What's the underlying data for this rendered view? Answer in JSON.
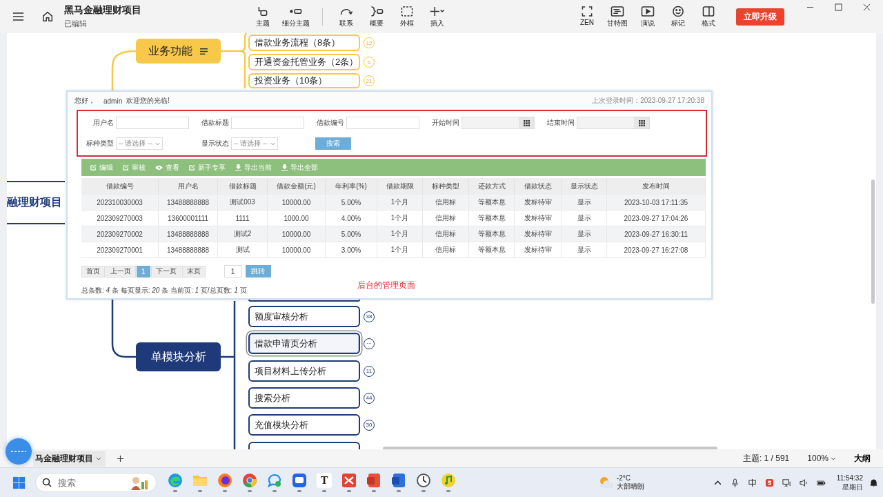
{
  "app": {
    "title": "黑马金融理财项目",
    "subtitle": "已编辑"
  },
  "toolbar": {
    "tools": [
      {
        "label": "主题",
        "kind": "topic"
      },
      {
        "label": "细分主题",
        "kind": "subtopic"
      },
      {
        "label": "联系",
        "kind": "relation"
      },
      {
        "label": "概要",
        "kind": "summary"
      },
      {
        "label": "外框",
        "kind": "boundary"
      },
      {
        "label": "插入",
        "kind": "insert"
      }
    ],
    "views": [
      {
        "label": "ZEN",
        "kind": "zen"
      },
      {
        "label": "甘特图",
        "kind": "gantt"
      },
      {
        "label": "演说",
        "kind": "play"
      },
      {
        "label": "标记",
        "kind": "marker"
      },
      {
        "label": "格式",
        "kind": "format"
      }
    ],
    "upgrade_button": "立即升级"
  },
  "mindmap": {
    "root": "融理财项目",
    "branches": [
      {
        "title": "业务功能",
        "color": "#f7c84a",
        "children": [
          {
            "label": "借款业务流程（8条）",
            "count": "12",
            "selected": false
          },
          {
            "label": "开通资金托管业务（2条）",
            "count": "6",
            "selected": false
          },
          {
            "label": "投资业务（10条）",
            "count": "21",
            "selected": false
          }
        ]
      },
      {
        "title": "单模块分析",
        "color": "#1f3a7a",
        "children": [
          {
            "label": "额度审核分析",
            "count": "38",
            "selected": false
          },
          {
            "label": "借款申请页分析",
            "count": "···",
            "selected": true
          },
          {
            "label": "项目材料上传分析",
            "count": "11",
            "selected": false
          },
          {
            "label": "搜索分析",
            "count": "44",
            "selected": false
          },
          {
            "label": "充值模块分析",
            "count": "30",
            "selected": false
          }
        ]
      }
    ]
  },
  "admin_panel": {
    "greeting": "您好，",
    "user": "admin",
    "welcome": "欢迎您的光临!",
    "last_login": "上次登录时间：2023-09-27 17:20:38",
    "filter_rows": [
      [
        {
          "label": "用户名",
          "kind": "text"
        },
        {
          "label": "借款标题",
          "kind": "text"
        },
        {
          "label": "借款编号",
          "kind": "text"
        },
        {
          "label": "开始时间",
          "kind": "date"
        },
        {
          "label": "结束时间",
          "kind": "date"
        }
      ],
      [
        {
          "label": "标种类型",
          "kind": "select",
          "placeholder": "-- 请选择 --"
        },
        {
          "label": "显示状态",
          "kind": "select",
          "placeholder": "-- 请选择 --"
        }
      ]
    ],
    "search_button": "搜索",
    "actions": [
      {
        "label": "编辑",
        "kind": "edit"
      },
      {
        "label": "审核",
        "kind": "edit"
      },
      {
        "label": "查看",
        "kind": "view"
      },
      {
        "label": "新手专享",
        "kind": "edit"
      },
      {
        "label": "导出当前",
        "kind": "export"
      },
      {
        "label": "导出全部",
        "kind": "export"
      }
    ],
    "table": {
      "columns": [
        "借款编号",
        "用户名",
        "借款标题",
        "借款金额(元)",
        "年利率(%)",
        "借款期限",
        "标种类型",
        "还款方式",
        "借款状态",
        "显示状态",
        "发布时间"
      ],
      "rows": [
        [
          "202310030003",
          "13488888888",
          "测试003",
          "10000.00",
          "5.00%",
          "1个月",
          "信用标",
          "等额本息",
          "发标待审",
          "显示",
          "2023-10-03 17:11:35"
        ],
        [
          "202309270003",
          "13600001111",
          "1111",
          "1000.00",
          "4.00%",
          "1个月",
          "信用标",
          "等额本息",
          "发标待审",
          "显示",
          "2023-09-27 17:04:26"
        ],
        [
          "202309270002",
          "13488888888",
          "测试2",
          "10000.00",
          "5.00%",
          "1个月",
          "信用标",
          "等额本息",
          "发标待审",
          "显示",
          "2023-09-27 16:30:11"
        ],
        [
          "202309270001",
          "13488888888",
          "测试",
          "10000.00",
          "3.00%",
          "1个月",
          "信用标",
          "等额本息",
          "发标待审",
          "显示",
          "2023-09-27 16:27:08"
        ]
      ]
    },
    "pagination": {
      "pages": [
        {
          "label": "首页",
          "selected": false
        },
        {
          "label": "上一页",
          "selected": false
        },
        {
          "label": "1",
          "selected": true
        },
        {
          "label": "下一页",
          "selected": false
        },
        {
          "label": "末页",
          "selected": false
        }
      ],
      "page_input": "1",
      "go_button": "跳转",
      "summary": "总条数: *4* 条 每页显示: *20* 条 当前页: *1* 页/总页数: *1* 页"
    },
    "annotation": "后台的管理页面"
  },
  "status_bar": {
    "tab": "马金融理财项目",
    "topic_count": "主题: 1 / 591",
    "zoom": "100%",
    "outline": "大纲"
  },
  "taskbar": {
    "search_placeholder": "搜索",
    "apps": [
      {
        "kind": "edge"
      },
      {
        "kind": "folder"
      },
      {
        "kind": "firefox"
      },
      {
        "kind": "chrome"
      },
      {
        "kind": "chat"
      },
      {
        "kind": "blueapp"
      },
      {
        "kind": "letter",
        "glyph": "T"
      },
      {
        "kind": "redapp"
      },
      {
        "kind": "slides"
      },
      {
        "kind": "docs"
      },
      {
        "kind": "clock"
      },
      {
        "kind": "music"
      }
    ],
    "weather": {
      "temp": "-2°C",
      "desc": "大部晴朗"
    },
    "clock": {
      "time": "11:54:32",
      "day": "星期日"
    }
  }
}
